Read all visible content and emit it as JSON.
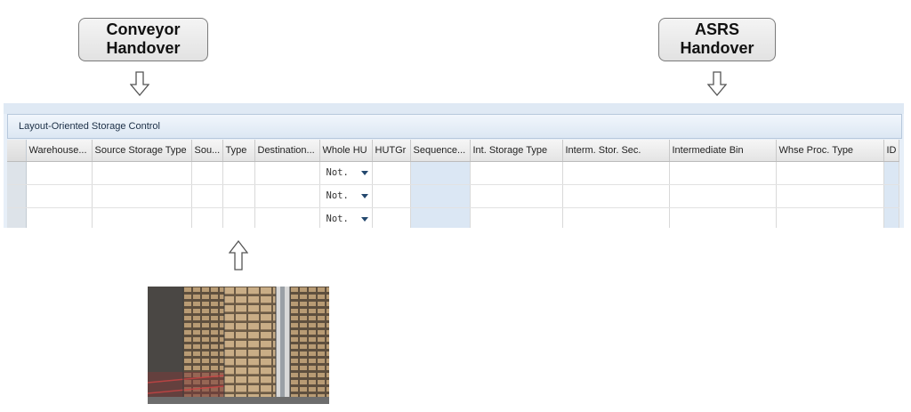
{
  "callouts": {
    "left": {
      "line1": "Conveyor",
      "line2": "Handover"
    },
    "right": {
      "line1": "ASRS",
      "line2": "Handover"
    }
  },
  "panel": {
    "title": "Layout-Oriented Storage Control",
    "columns": [
      "Warehouse...",
      "Source Storage Type",
      "Sou...",
      "Type",
      "Destination...",
      "Whole HU",
      "HUTGr",
      "Sequence...",
      "Int. Storage Type",
      "Interm. Stor. Sec.",
      "Intermediate Bin",
      "Whse Proc. Type",
      "ID P"
    ],
    "rows": [
      {
        "whole_hu": "Not."
      },
      {
        "whole_hu": "Not."
      },
      {
        "whole_hu": "Not."
      }
    ]
  },
  "colors": {
    "panel_bg": "#e7eff8",
    "highlight_column": "#dbe7f4",
    "dropdown_caret": "#24486e"
  },
  "icons": {
    "down_arrow": "down-arrow-icon",
    "up_arrow": "up-arrow-icon",
    "dropdown": "dropdown-caret-icon"
  }
}
